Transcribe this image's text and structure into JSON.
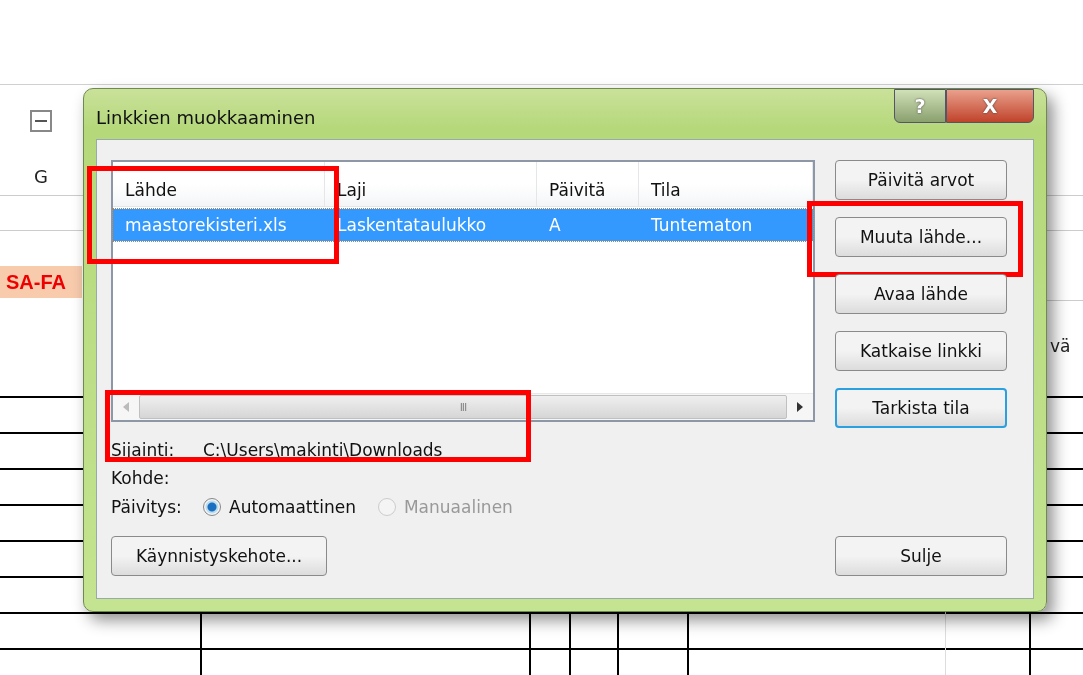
{
  "spreadsheet": {
    "column_header": "G",
    "cell_left": "SA-FA",
    "cell_right": "vä"
  },
  "window": {
    "title": "Linkkien muokkaaminen",
    "help": "?",
    "close": "X"
  },
  "links": {
    "columns": [
      {
        "label": "Lähde"
      },
      {
        "label": "Laji"
      },
      {
        "label": "Päivitä"
      },
      {
        "label": "Tila"
      }
    ],
    "source_highlighted": true,
    "rows": [
      {
        "cells": [
          "maastorekisteri.xls",
          "Laskentataulukko",
          "A",
          "Tuntematon"
        ],
        "selected": true
      }
    ],
    "scroll_grip": "III"
  },
  "buttons": [
    {
      "label": "Päivitä arvot",
      "highlighted": false,
      "focused": false
    },
    {
      "label": "Muuta lähde...",
      "highlighted": true,
      "focused": false
    },
    {
      "label": "Avaa lähde",
      "highlighted": false,
      "focused": false
    },
    {
      "label": "Katkaise linkki",
      "highlighted": false,
      "focused": false
    },
    {
      "label": "Tarkista tila",
      "highlighted": false,
      "focused": true
    }
  ],
  "location": {
    "label": "Sijainti:",
    "value": "C:\\Users\\makinti\\Downloads",
    "highlighted": true
  },
  "target": {
    "label": "Kohde:"
  },
  "update": {
    "label": "Päivitys:",
    "options": [
      {
        "label": "Automaattinen",
        "selected": true,
        "disabled": false
      },
      {
        "label": "Manuaalinen",
        "selected": false,
        "disabled": true
      }
    ]
  },
  "startup_button": "Käynnistyskehote...",
  "close_button": "Sulje"
}
